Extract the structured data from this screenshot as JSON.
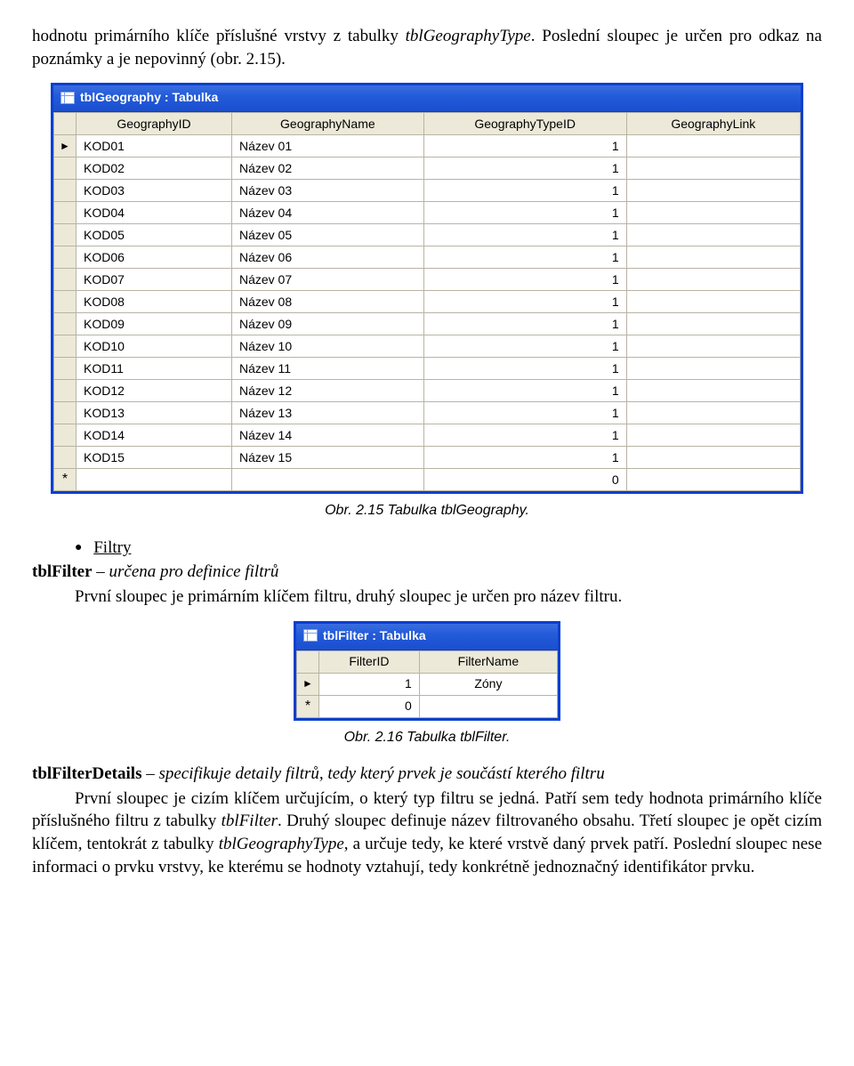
{
  "para1_a": "hodnotu primárního klíče příslušné vrstvy z tabulky ",
  "para1_b": "tblGeographyType",
  "para1_c": ". Poslední sloupec je určen pro odkaz na poznámky a je nepovinný (obr. 2.15).",
  "win1": {
    "title": "tblGeography : Tabulka",
    "headers": [
      "",
      "GeographyID",
      "GeographyName",
      "GeographyTypeID",
      "GeographyLink"
    ],
    "rows": [
      {
        "sel": "►",
        "id": "KOD01",
        "name": "Název 01",
        "type": "1",
        "link": ""
      },
      {
        "sel": "",
        "id": "KOD02",
        "name": "Název 02",
        "type": "1",
        "link": ""
      },
      {
        "sel": "",
        "id": "KOD03",
        "name": "Název 03",
        "type": "1",
        "link": ""
      },
      {
        "sel": "",
        "id": "KOD04",
        "name": "Název 04",
        "type": "1",
        "link": ""
      },
      {
        "sel": "",
        "id": "KOD05",
        "name": "Název 05",
        "type": "1",
        "link": ""
      },
      {
        "sel": "",
        "id": "KOD06",
        "name": "Název 06",
        "type": "1",
        "link": ""
      },
      {
        "sel": "",
        "id": "KOD07",
        "name": "Název 07",
        "type": "1",
        "link": ""
      },
      {
        "sel": "",
        "id": "KOD08",
        "name": "Název 08",
        "type": "1",
        "link": ""
      },
      {
        "sel": "",
        "id": "KOD09",
        "name": "Název 09",
        "type": "1",
        "link": ""
      },
      {
        "sel": "",
        "id": "KOD10",
        "name": "Název 10",
        "type": "1",
        "link": ""
      },
      {
        "sel": "",
        "id": "KOD11",
        "name": "Název 11",
        "type": "1",
        "link": ""
      },
      {
        "sel": "",
        "id": "KOD12",
        "name": "Název 12",
        "type": "1",
        "link": ""
      },
      {
        "sel": "",
        "id": "KOD13",
        "name": "Název 13",
        "type": "1",
        "link": ""
      },
      {
        "sel": "",
        "id": "KOD14",
        "name": "Název 14",
        "type": "1",
        "link": ""
      },
      {
        "sel": "",
        "id": "KOD15",
        "name": "Název 15",
        "type": "1",
        "link": ""
      }
    ],
    "newrow": {
      "sel": "*",
      "id": "",
      "name": "",
      "type": "0",
      "link": ""
    }
  },
  "caption1": "Obr. 2.15 Tabulka tblGeography.",
  "bullet_filtry": "Filtry",
  "para2_a": "tblFilter",
  "para2_b": " – určena pro definice filtrů",
  "para2_c": "První sloupec je primárním klíčem filtru, druhý sloupec je určen pro název filtru.",
  "win2": {
    "title": "tblFilter : Tabulka",
    "headers": [
      "",
      "FilterID",
      "FilterName"
    ],
    "row": {
      "sel": "►",
      "id": "1",
      "name": "Zóny"
    },
    "newrow": {
      "sel": "*",
      "id": "0",
      "name": ""
    }
  },
  "caption2": "Obr. 2.16 Tabulka tblFilter.",
  "para3_a": "tblFilterDetails",
  "para3_b": " – specifikuje detaily filtrů, tedy který prvek je součástí kterého filtru",
  "para3_c": "První sloupec je cizím klíčem určujícím, o který typ filtru se jedná. Patří sem tedy hodnota primárního klíče příslušného filtru z tabulky ",
  "para3_d": "tblFilter",
  "para3_e": ". Druhý sloupec definuje název filtrovaného obsahu. Třetí sloupec je opět cizím klíčem, tentokrát z tabulky ",
  "para3_f": "tblGeographyType",
  "para3_g": ", a určuje tedy, ke které vrstvě daný prvek patří. Poslední sloupec nese informaci o prvku vrstvy, ke kterému se hodnoty vztahují, tedy konkrétně jednoznačný identifikátor prvku."
}
